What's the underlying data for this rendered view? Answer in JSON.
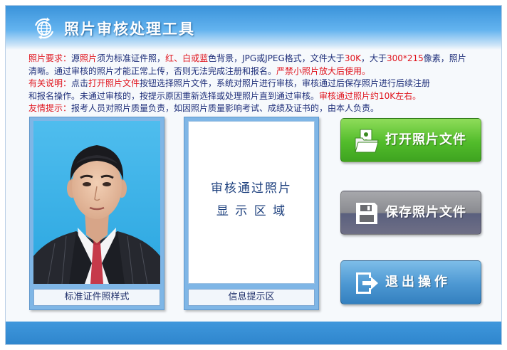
{
  "app": {
    "title": "照片审核处理工具",
    "logo_icon": "globe-sync-icon"
  },
  "requirements": {
    "line1": [
      {
        "text": "照片要求：",
        "style": "red"
      },
      {
        "text": "源",
        "style": "normal"
      },
      {
        "text": "照片",
        "style": "red"
      },
      {
        "text": "须为标准证件照，",
        "style": "normal"
      },
      {
        "text": "红、白或蓝",
        "style": "red"
      },
      {
        "text": "色背景，JPG或JPEG格式，文件大于",
        "style": "normal"
      },
      {
        "text": "30K",
        "style": "red"
      },
      {
        "text": "，大于",
        "style": "normal"
      },
      {
        "text": "300*215",
        "style": "red"
      },
      {
        "text": "像素，照片",
        "style": "normal"
      }
    ],
    "line2": [
      {
        "text": "清晰。通过审核的照片才能正常上传，否则无法完成注册和报名。",
        "style": "normal"
      },
      {
        "text": "严禁小照片放大后使用。",
        "style": "red"
      }
    ],
    "line3": [
      {
        "text": "有关说明：",
        "style": "red"
      },
      {
        "text": "点击",
        "style": "normal"
      },
      {
        "text": "打开照片文件",
        "style": "red"
      },
      {
        "text": "按钮选择照片文件，系统对照片进行审核，审核通过后保存照片进行后续注册",
        "style": "normal"
      }
    ],
    "line4": [
      {
        "text": "和报名操作。未通过审核的，按提示原因重新选择或处理照片直到通过审核。",
        "style": "normal"
      },
      {
        "text": "审核通过照片约10K左右。",
        "style": "red"
      }
    ],
    "line5": [
      {
        "text": "友情提示：",
        "style": "red"
      },
      {
        "text": "报考人员对照片质量负责，如因照片质量影响考试、成绩及证书的，由本人负责。",
        "style": "normal"
      }
    ]
  },
  "sample_photo": {
    "caption": "标准证件照样式"
  },
  "result_box": {
    "line1": "审核通过照片",
    "line2": "显 示 区 域",
    "caption": "信息提示区"
  },
  "buttons": {
    "open": {
      "label": "打开照片文件",
      "icon": "open-folder-icon"
    },
    "save": {
      "label": "保存照片文件",
      "icon": "save-disk-icon"
    },
    "exit": {
      "label": "退出操作",
      "icon": "exit-arrow-icon"
    }
  },
  "colors": {
    "header": "#3a93da",
    "highlight_red": "#e0141d",
    "text_blue": "#1f2f7a",
    "open_green": "#52bc2b",
    "save_gray": "#8a8b90",
    "exit_blue": "#4c97d2"
  }
}
